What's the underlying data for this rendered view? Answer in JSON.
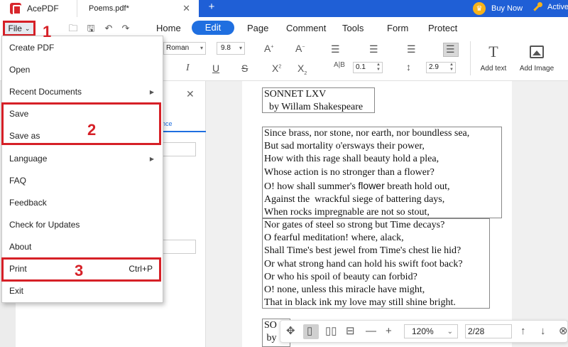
{
  "titlebar": {
    "app_name": "AcePDF",
    "doc_tab": "Poems.pdf*",
    "close_tab": "✕",
    "new_tab": "+",
    "buy_now": "Buy Now",
    "activate": "Active"
  },
  "menubar": {
    "file_label": "File",
    "tabs": [
      "Home",
      "Edit",
      "Page",
      "Comment",
      "Tools",
      "Form",
      "Protect"
    ],
    "active_tab": "Edit"
  },
  "ribbon": {
    "font_name": "Roman",
    "font_size": "9.8",
    "char_spacing": "0.1",
    "line_spacing": "2.9",
    "add_text": "Add text",
    "add_image": "Add Image",
    "text_icon": "T"
  },
  "file_menu": {
    "items": [
      {
        "label": "Create PDF"
      },
      {
        "label": "Open"
      },
      {
        "label": "Recent Documents",
        "submenu": true
      },
      {
        "label": "Save"
      },
      {
        "label": "Save as"
      },
      {
        "label": "Language",
        "submenu": true
      },
      {
        "label": "FAQ"
      },
      {
        "label": "Feedback"
      },
      {
        "label": "Check for Updates"
      },
      {
        "label": "About"
      },
      {
        "label": "Print",
        "shortcut": "Ctrl+P"
      },
      {
        "label": "Exit"
      }
    ]
  },
  "side_panel": {
    "tab_label": "nce",
    "close": "✕"
  },
  "annotations": [
    "1",
    "2",
    "3"
  ],
  "document": {
    "title_lines": [
      "SONNET LXV",
      "  by Willam Shakespeare"
    ],
    "stanza1": [
      "Since brass, nor stone, nor earth, nor boundless sea,",
      "But sad mortality o'ersways their power,",
      "How with this rage shall beauty hold a plea,",
      "Whose action is no stronger than a flower?",
      "O! how shall summer's ",
      "flower",
      " breath hold out,",
      "Against the  wrackful siege of battering days,",
      "When rocks impregnable are not so stout,"
    ],
    "stanza2": [
      "Nor gates of steel so strong but Time decays?",
      "O fearful meditation! where, alack,",
      "Shall Time's best jewel from Time's chest lie hid?",
      "Or what strong hand can hold his swift foot back?",
      "Or who his spoil of beauty can forbid?",
      "O! none, unless this miracle have might,",
      "That in black ink my love may still shine bright."
    ],
    "stanza3": [
      "SO",
      " by"
    ]
  },
  "viewbar": {
    "zoom": "120%",
    "page": "2/28"
  },
  "colors": {
    "titlebar": "#1f5fd6",
    "accent": "#1f6fe0",
    "annotation_red": "#d62027"
  }
}
